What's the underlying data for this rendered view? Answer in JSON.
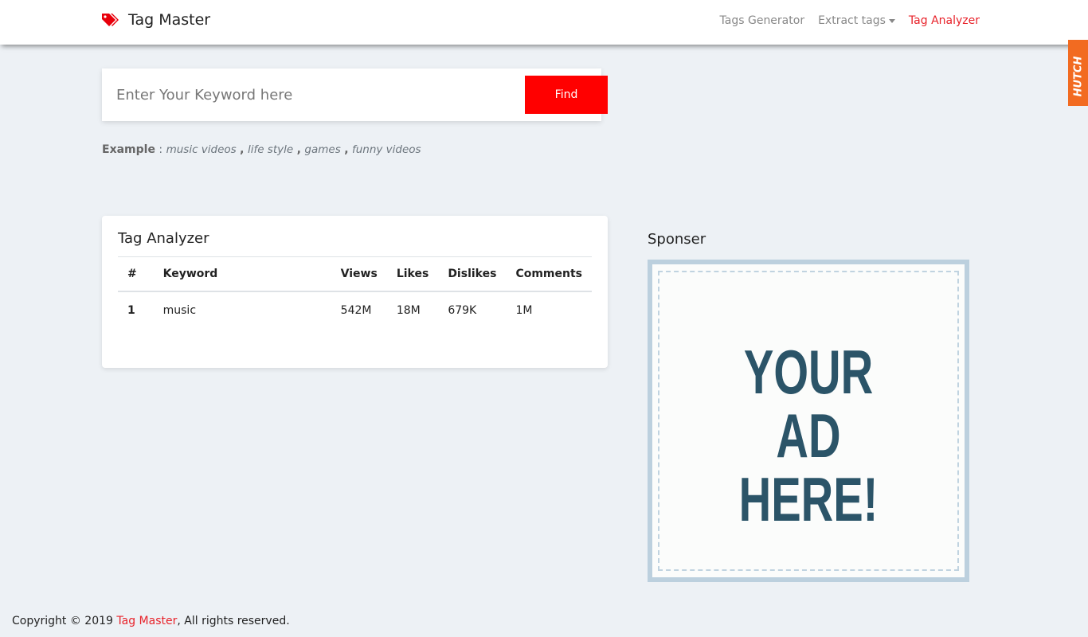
{
  "nav": {
    "brand": "Tag Master",
    "links": [
      "Tags Generator",
      "Extract tags",
      "Tag Analyzer"
    ]
  },
  "search": {
    "placeholder": "Enter Your Keyword here",
    "button": "Find"
  },
  "example": {
    "label": "Example",
    "sep": " : ",
    "items": [
      "music videos",
      "life style",
      "games",
      "funny videos"
    ]
  },
  "analyzer": {
    "title": "Tag Analyzer",
    "columns": [
      "#",
      "Keyword",
      "Views",
      "Likes",
      "Dislikes",
      "Comments"
    ],
    "rows": [
      [
        "1",
        "music",
        "542M",
        "18M",
        "679K",
        "1M"
      ]
    ]
  },
  "sponsor": {
    "title": "Sponser",
    "ad_text": "YOUR AD HERE!"
  },
  "footer": {
    "prefix": "Copyright © 2019 ",
    "brand": "Tag Master",
    "suffix": ", All rights reserved."
  },
  "hutch": {
    "label": "HUTCH"
  },
  "colors": {
    "accent": "#ff0000",
    "background": "#edf1f5"
  }
}
